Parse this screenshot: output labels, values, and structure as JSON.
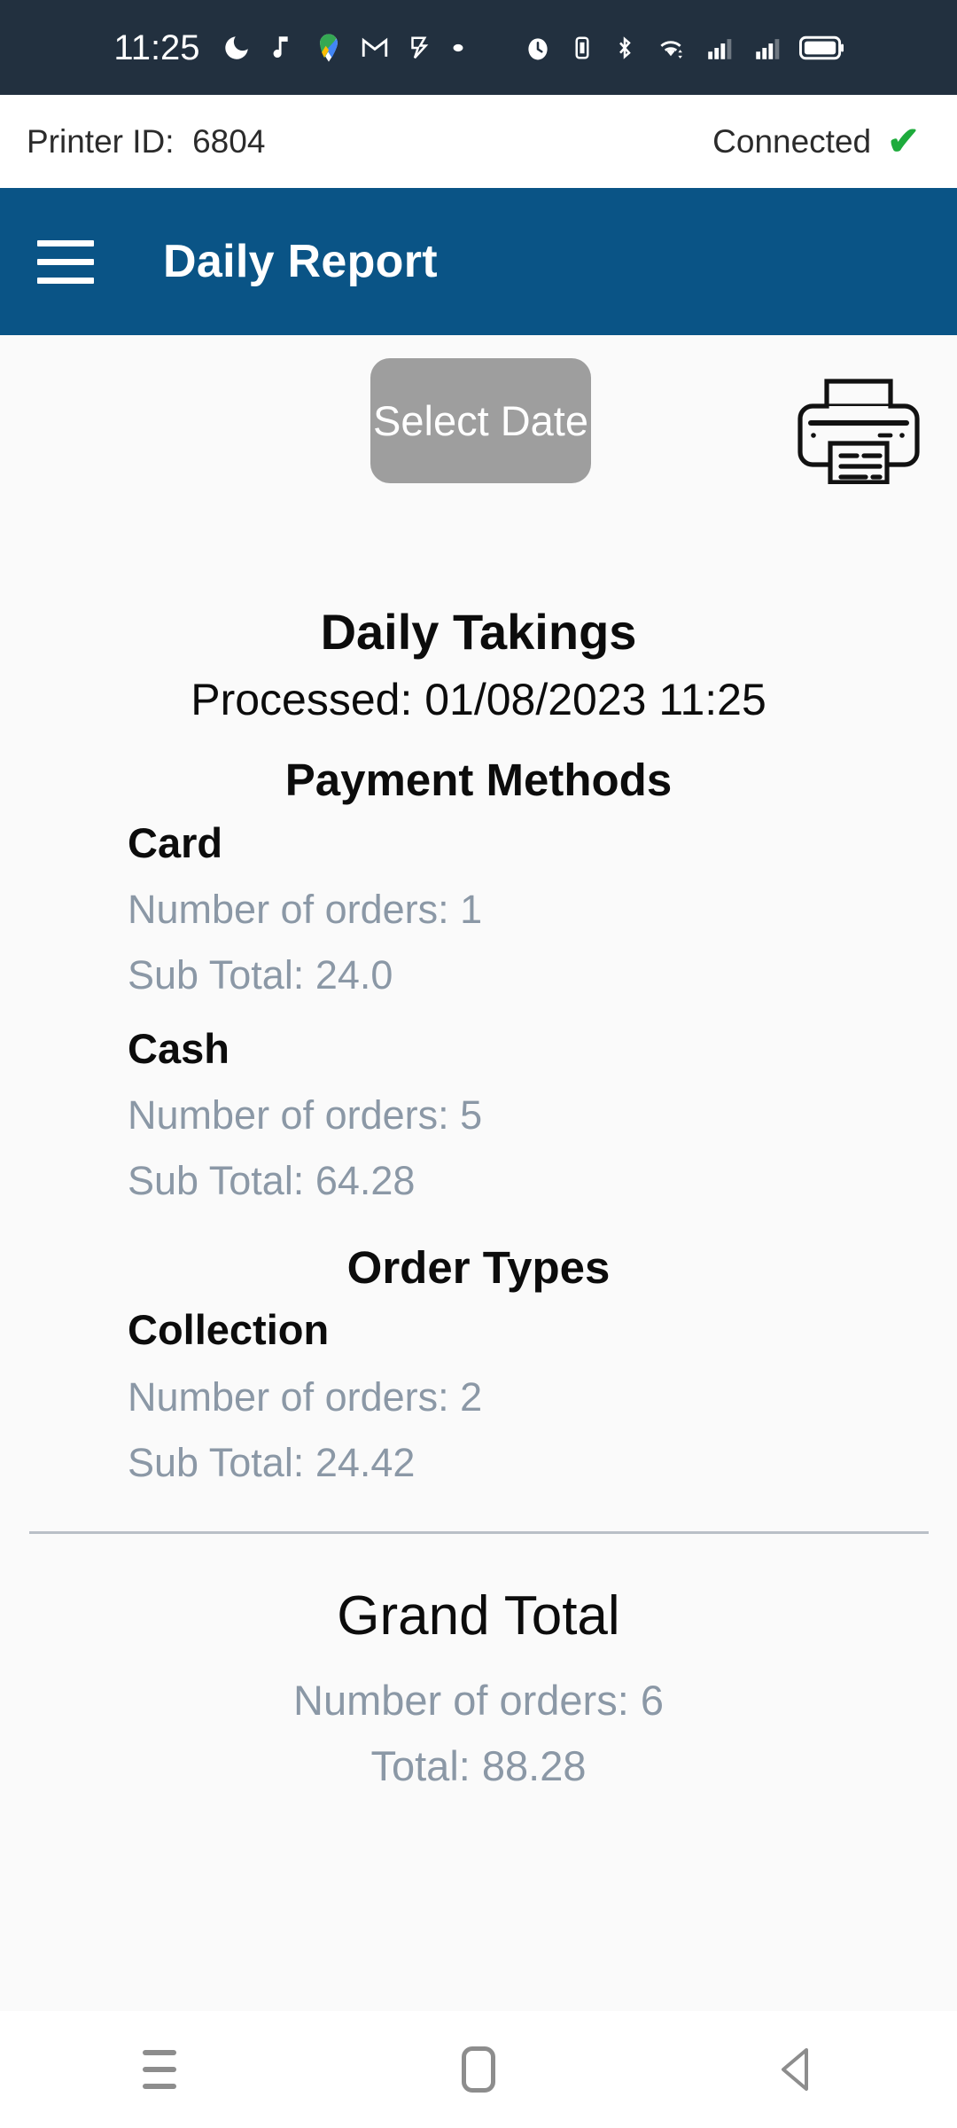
{
  "status_bar": {
    "time": "11:25",
    "icons": [
      "do-not-disturb-moon-icon",
      "music-note-icon",
      "maps-icon",
      "gmail-icon",
      "bolt-icon",
      "dot-icon",
      "alarm-icon",
      "vibrate-icon",
      "bluetooth-icon",
      "wifi-icon",
      "signal-bars-sim1-icon",
      "signal-bars-sim2-icon",
      "battery-icon"
    ],
    "background_color": "#22303f"
  },
  "printer_status": {
    "label": "Printer ID:  6804",
    "connection_text": "Connected",
    "check_glyph": "✔",
    "check_color": "#1eab3c"
  },
  "app_bar": {
    "menu_icon": "hamburger-menu-icon",
    "title": "Daily Report",
    "background_color": "#0a5486"
  },
  "toolbar": {
    "select_date_label": "Select Date",
    "select_date_color": "#9e9e9e",
    "print_icon": "printer-icon"
  },
  "report": {
    "title": "Daily Takings",
    "processed": "Processed: 01/08/2023 11:25",
    "sections": [
      {
        "heading": "Payment Methods",
        "groups": [
          {
            "name": "Card",
            "orders": "Number of orders: 1",
            "subtotal": "Sub Total: 24.0"
          },
          {
            "name": "Cash",
            "orders": "Number of orders: 5",
            "subtotal": "Sub Total: 64.28"
          }
        ]
      },
      {
        "heading": "Order Types",
        "groups": [
          {
            "name": "Collection",
            "orders": "Number of orders: 2",
            "subtotal": "Sub Total: 24.42"
          }
        ]
      }
    ],
    "grand_total": {
      "title": "Grand Total",
      "orders": "Number of orders: 6",
      "total": "Total: 88.28"
    },
    "muted_color": "#8b98a6"
  },
  "nav_bar": {
    "recents": "recents-icon",
    "home": "home-icon",
    "back": "back-icon"
  }
}
